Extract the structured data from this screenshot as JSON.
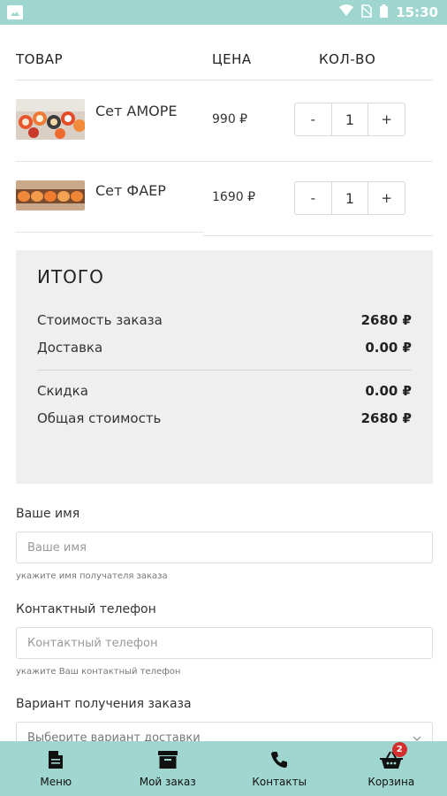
{
  "status_bar": {
    "time": "15:30"
  },
  "table": {
    "headers": {
      "product": "ТОВАР",
      "price": "ЦЕНА",
      "qty": "КОЛ-ВО"
    },
    "items": [
      {
        "name": "Сет АМОРЕ",
        "price": "990 ₽",
        "qty": "1",
        "minus": "-",
        "plus": "+"
      },
      {
        "name": "Сет ФАЕР",
        "price": "1690 ₽",
        "qty": "1",
        "minus": "-",
        "plus": "+"
      }
    ]
  },
  "summary": {
    "title": "ИТОГО",
    "order_cost_label": "Стоимость заказа",
    "order_cost_value": "2680 ₽",
    "delivery_label": "Доставка",
    "delivery_value": "0.00 ₽",
    "discount_label": "Скидка",
    "discount_value": "0.00 ₽",
    "total_label": "Общая стоимость",
    "total_value": "2680 ₽"
  },
  "form": {
    "name_label": "Ваше имя",
    "name_placeholder": "Ваше имя",
    "name_hint": "укажите имя получателя заказа",
    "phone_label": "Контактный телефон",
    "phone_placeholder": "Контактный телефон",
    "phone_hint": "укажите Ваш контактный телефон",
    "delivery_label": "Вариант получения заказа",
    "delivery_select": "Выберите вариант доставки"
  },
  "bottom_nav": {
    "menu": "Меню",
    "my_order": "Мой заказ",
    "contacts": "Контакты",
    "cart": "Корзина",
    "cart_badge": "2"
  },
  "colors": {
    "accent": "#9fd6d0",
    "summary_bg": "#efefef",
    "badge": "#d32f2f"
  }
}
